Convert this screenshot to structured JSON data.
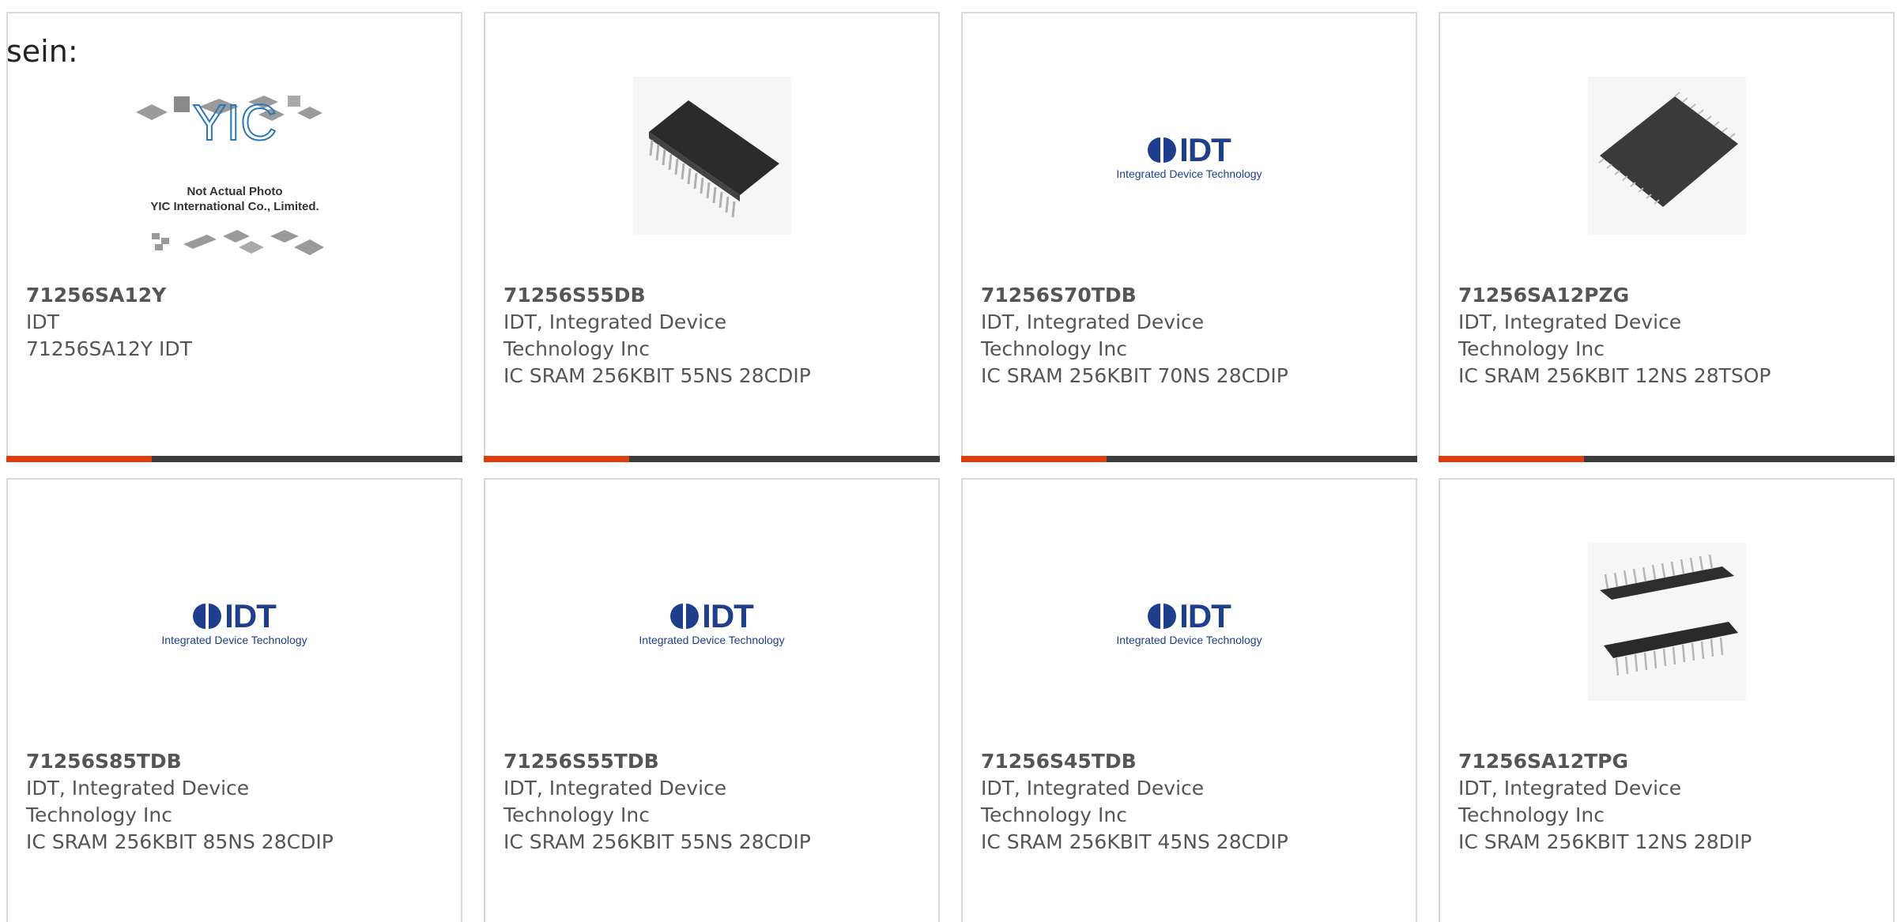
{
  "intro": "sein:",
  "colors": {
    "accent": "#e03d0e",
    "bar": "#3c3c3c",
    "border": "#d9d9d9",
    "logo": "#1f3e8c"
  },
  "yic_image": {
    "brand": "YIC",
    "line1": "Not Actual Photo",
    "line2": "YIC International Co., Limited."
  },
  "idt_logo": {
    "word": "IDT",
    "sub": "Integrated Device Technology"
  },
  "products": [
    {
      "part": "71256SA12Y",
      "mfr_line1": "IDT",
      "mfr_line2": "",
      "desc": "71256SA12Y IDT",
      "image": "yic-placeholder-image"
    },
    {
      "part": "71256S55DB",
      "mfr_line1": "IDT, Integrated Device",
      "mfr_line2": "Technology Inc",
      "desc": "IC SRAM 256KBIT 55NS 28CDIP",
      "image": "cdip-chip-image"
    },
    {
      "part": "71256S70TDB",
      "mfr_line1": "IDT, Integrated Device",
      "mfr_line2": "Technology Inc",
      "desc": "IC SRAM 256KBIT 70NS 28CDIP",
      "image": "idt-logo"
    },
    {
      "part": "71256SA12PZG",
      "mfr_line1": "IDT, Integrated Device",
      "mfr_line2": "Technology Inc",
      "desc": "IC SRAM 256KBIT 12NS 28TSOP",
      "image": "tsop-chip-image"
    },
    {
      "part": "71256S85TDB",
      "mfr_line1": "IDT, Integrated Device",
      "mfr_line2": "Technology Inc",
      "desc": "IC SRAM 256KBIT 85NS 28CDIP",
      "image": "idt-logo"
    },
    {
      "part": "71256S55TDB",
      "mfr_line1": "IDT, Integrated Device",
      "mfr_line2": "Technology Inc",
      "desc": "IC SRAM 256KBIT 55NS 28CDIP",
      "image": "idt-logo"
    },
    {
      "part": "71256S45TDB",
      "mfr_line1": "IDT, Integrated Device",
      "mfr_line2": "Technology Inc",
      "desc": "IC SRAM 256KBIT 45NS 28CDIP",
      "image": "idt-logo"
    },
    {
      "part": "71256SA12TPG",
      "mfr_line1": "IDT, Integrated Device",
      "mfr_line2": "Technology Inc",
      "desc": "IC SRAM 256KBIT 12NS 28DIP",
      "image": "dip-chip-image"
    }
  ]
}
